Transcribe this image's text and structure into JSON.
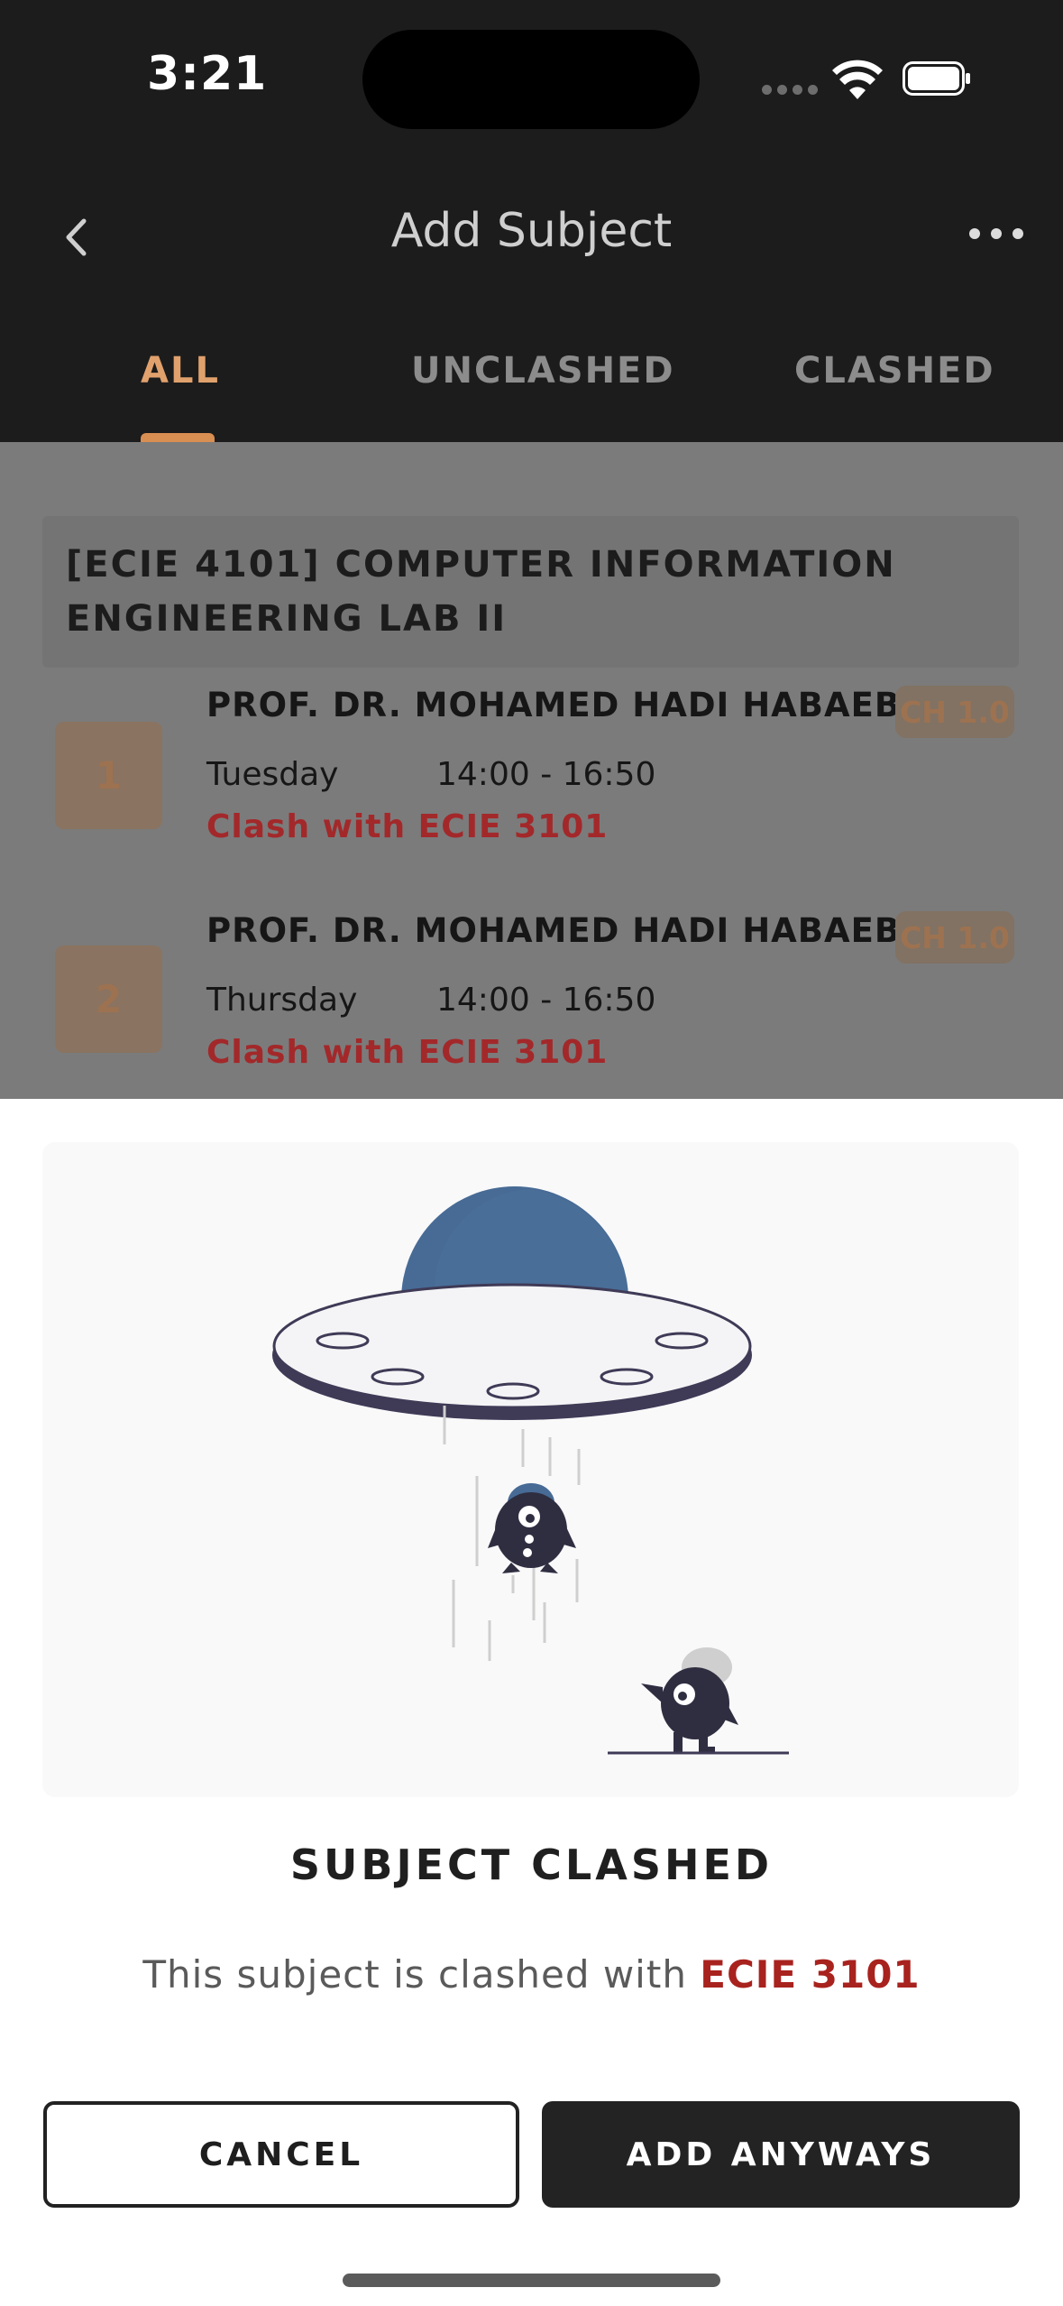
{
  "status_bar": {
    "time": "3:21"
  },
  "header": {
    "title": "Add Subject",
    "tabs": [
      {
        "label": "ALL",
        "active": true
      },
      {
        "label": "UNCLASHED",
        "active": false
      },
      {
        "label": "CLASHED",
        "active": false
      }
    ]
  },
  "subject": {
    "title": "[ECIE 4101] COMPUTER INFORMATION ENGINEERING LAB II",
    "sections": [
      {
        "number": "1",
        "lecturer": "PROF. DR. MOHAMED HADI HABAEBI",
        "credit": "CH 1.0",
        "day": "Tuesday",
        "time": "14:00 - 16:50",
        "clash": "Clash with ECIE 3101"
      },
      {
        "number": "2",
        "lecturer": "PROF. DR. MOHAMED HADI HABAEBI",
        "credit": "CH 1.0",
        "day": "Thursday",
        "time": "14:00 - 16:50",
        "clash": "Clash with ECIE 3101"
      }
    ]
  },
  "dialog": {
    "title": "SUBJECT CLASHED",
    "message_prefix": "This subject is clashed with ",
    "message_highlight": "ECIE 3101",
    "cancel_label": "CANCEL",
    "confirm_label": "ADD ANYWAYS"
  },
  "colors": {
    "accent": "#e1a16d",
    "clash_red": "#a8221e",
    "header_bg": "#1c1c1c",
    "ufo_blue": "#476b95"
  },
  "icons": {
    "back": "chevron-left-icon",
    "more": "more-horizontal-icon",
    "wifi": "wifi-icon",
    "battery": "battery-icon"
  }
}
